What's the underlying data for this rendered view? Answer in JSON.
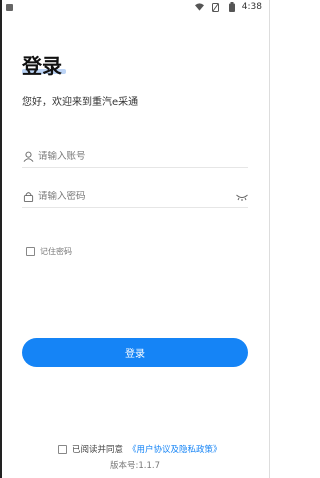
{
  "status_bar": {
    "time": "4:38"
  },
  "login": {
    "title": "登录",
    "welcome": "您好，欢迎来到重汽e采通",
    "account_placeholder": "请输入账号",
    "password_placeholder": "请输入密码",
    "remember_label": "记住密码",
    "login_button": "登录"
  },
  "footer": {
    "agree_prefix": "已阅读并同意",
    "agreement_link": "《用户协议及隐私政策》",
    "version": "版本号:1.1.7"
  },
  "colors": {
    "accent": "#1584f6"
  }
}
